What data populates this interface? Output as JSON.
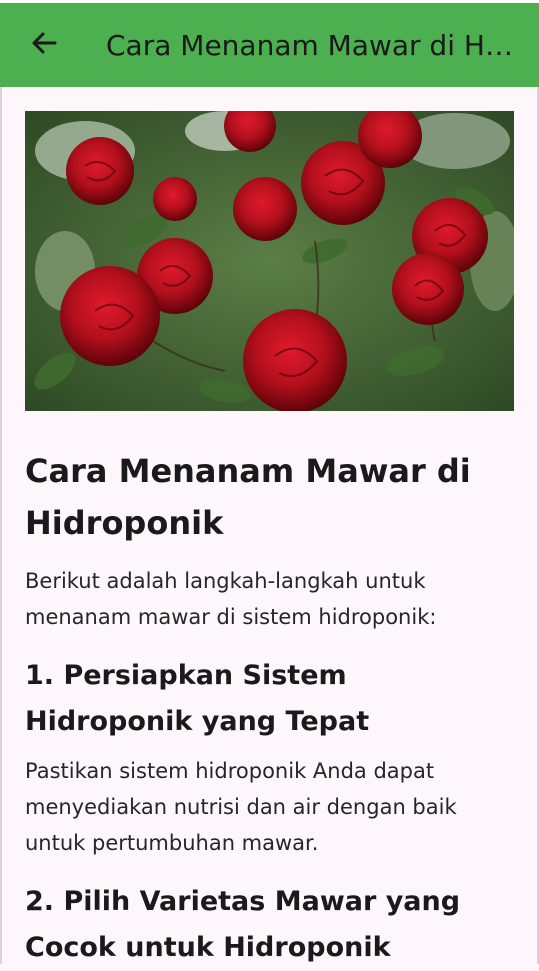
{
  "appbar": {
    "title": "Cara Menanam Mawar di Hidroponik",
    "back_icon": "arrow-left-icon"
  },
  "hero_image": {
    "subject": "red roses"
  },
  "article": {
    "title": "Cara Menanam Mawar di Hidroponik",
    "intro": "Berikut adalah langkah-langkah untuk menanam mawar di sistem hidroponik:",
    "steps": [
      {
        "heading": "1. Persiapkan Sistem Hidroponik yang Tepat",
        "body": "Pastikan sistem hidroponik Anda dapat menyediakan nutrisi dan air dengan baik untuk pertumbuhan mawar."
      },
      {
        "heading": "2. Pilih Varietas Mawar yang Cocok untuk Hidroponik",
        "body": ""
      }
    ]
  },
  "colors": {
    "appbar": "#4caf50",
    "background": "#fdf6fb",
    "rose": "#b3101c"
  }
}
